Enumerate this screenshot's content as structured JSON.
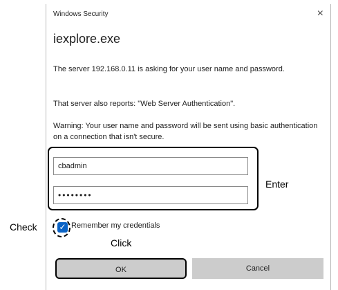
{
  "top_fragment": "",
  "dialog": {
    "window_title": "Windows Security",
    "close_glyph": "×",
    "app_name": "iexplore.exe",
    "message_1": "The server 192.168.0.11 is asking for your user name and password.",
    "message_2": "That server also reports: \"Web Server Authentication\".",
    "message_3": "Warning: Your user name and password will be sent using basic authentication on a connection that isn't secure.",
    "username_value": "cbadmin",
    "password_value": "••••••••",
    "remember_label": "Remember my credentials",
    "remember_checked": true,
    "ok_label": "OK",
    "cancel_label": "Cancel"
  },
  "annotations": {
    "enter_label": "Enter",
    "check_label": "Check",
    "click_label": "Click"
  },
  "icons": {
    "close": "close-icon",
    "checkbox": "checkmark-icon"
  },
  "colors": {
    "checkbox_fill": "#0b63c5",
    "button_bg": "#cccccc"
  }
}
